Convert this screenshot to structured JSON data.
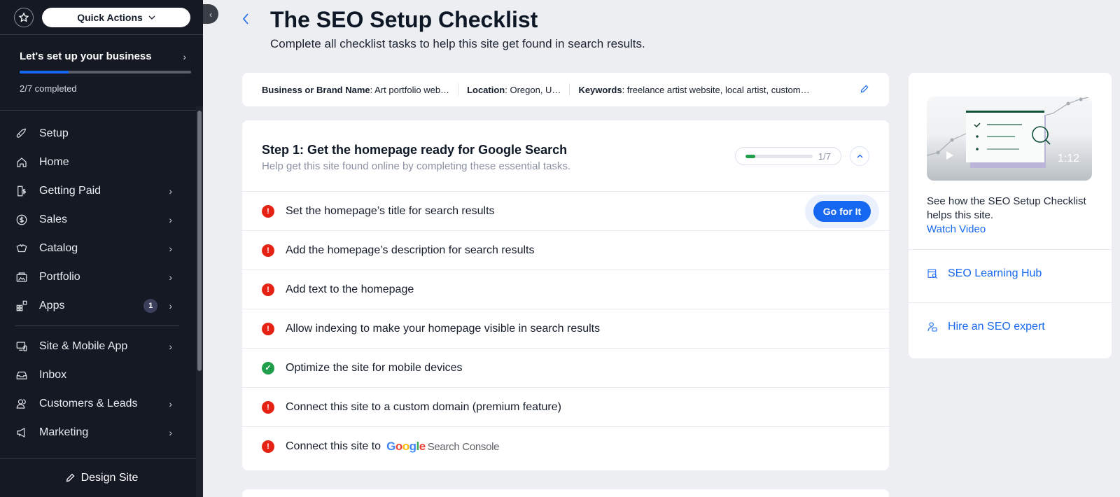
{
  "sidebar": {
    "quick_actions_label": "Quick Actions",
    "setup": {
      "title": "Let's set up your business",
      "completed_count": 2,
      "total_count": 7,
      "progress_text": "2/7 completed"
    },
    "nav_items": [
      {
        "label": "Setup",
        "icon": "rocket-icon",
        "has_chevron": false
      },
      {
        "label": "Home",
        "icon": "home-icon",
        "has_chevron": false
      },
      {
        "label": "Getting Paid",
        "icon": "invoice-dollar-icon",
        "has_chevron": true
      },
      {
        "label": "Sales",
        "icon": "dollar-circle-icon",
        "has_chevron": true
      },
      {
        "label": "Catalog",
        "icon": "catalog-icon",
        "has_chevron": true
      },
      {
        "label": "Portfolio",
        "icon": "portfolio-icon",
        "has_chevron": true
      },
      {
        "label": "Apps",
        "icon": "apps-icon",
        "has_chevron": true,
        "badge": "1"
      },
      {
        "label": "Site & Mobile App",
        "icon": "devices-icon",
        "has_chevron": true
      },
      {
        "label": "Inbox",
        "icon": "inbox-icon",
        "has_chevron": false
      },
      {
        "label": "Customers & Leads",
        "icon": "customers-icon",
        "has_chevron": true
      },
      {
        "label": "Marketing",
        "icon": "megaphone-icon",
        "has_chevron": true
      }
    ],
    "design_site_label": "Design Site"
  },
  "header": {
    "title": "The SEO Setup Checklist",
    "subtitle": "Complete all checklist tasks to help this site get found in search results."
  },
  "info_bar": {
    "business_label": "Business or Brand Name",
    "business_value": ": Art portfolio web…",
    "location_label": "Location",
    "location_value": ": Oregon, U…",
    "keywords_label": "Keywords",
    "keywords_value": ": freelance artist website, local artist, custom…"
  },
  "step": {
    "title": "Step 1: Get the homepage ready for Google Search",
    "subtitle": "Help get this site found online by completing these essential tasks.",
    "completed": 1,
    "total": 7,
    "progress_text": "1/7",
    "tasks": [
      {
        "label": "Set the homepage’s title for search results",
        "status": "incomplete",
        "action": "Go for It"
      },
      {
        "label": "Add the homepage’s description for search results",
        "status": "incomplete"
      },
      {
        "label": "Add text to the homepage",
        "status": "incomplete"
      },
      {
        "label": "Allow indexing to make your homepage visible in search results",
        "status": "incomplete"
      },
      {
        "label": "Optimize the site for mobile devices",
        "status": "complete"
      },
      {
        "label": "Connect this site to a custom domain (premium feature)",
        "status": "incomplete"
      },
      {
        "label": "Connect this site to",
        "status": "incomplete",
        "logo_google": "Google",
        "logo_suffix": "Search Console"
      }
    ]
  },
  "side_panel": {
    "video_duration": "1:12",
    "video_description": "See how the SEO Setup Checklist helps this site.",
    "watch_video_label": "Watch Video",
    "links": [
      {
        "label": "SEO Learning Hub",
        "icon": "learning-hub-icon"
      },
      {
        "label": "Hire an SEO expert",
        "icon": "expert-icon"
      }
    ]
  },
  "colors": {
    "accent": "#1668f0",
    "error": "#e62214",
    "success": "#219e4b",
    "sidebar_bg": "#141923"
  }
}
